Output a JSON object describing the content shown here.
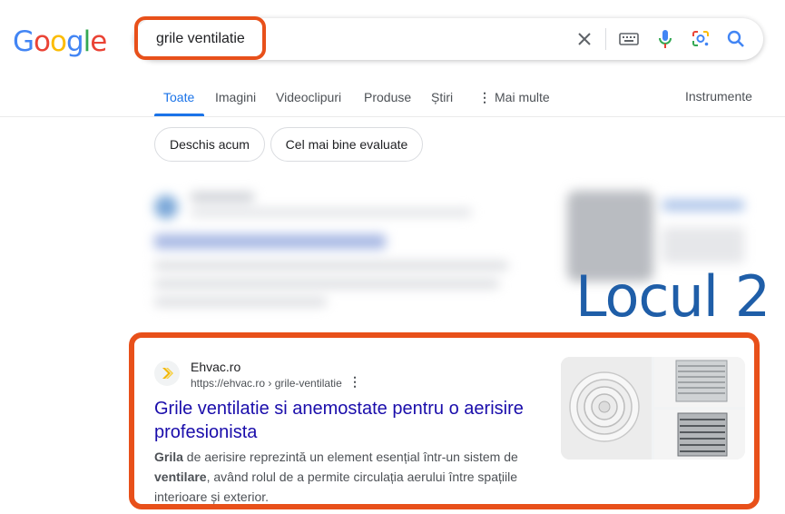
{
  "logo": {
    "letters": [
      "G",
      "o",
      "o",
      "g",
      "l",
      "e"
    ],
    "colors": [
      "#4285F4",
      "#EA4335",
      "#FBBC05",
      "#4285F4",
      "#34A853",
      "#EA4335"
    ]
  },
  "search": {
    "query": "grile ventilatie"
  },
  "tabs": [
    {
      "label": "Toate",
      "active": true
    },
    {
      "label": "Imagini"
    },
    {
      "label": "Videoclipuri"
    },
    {
      "label": "Produse"
    },
    {
      "label": "Știri"
    },
    {
      "label": "Mai multe"
    }
  ],
  "tools_label": "Instrumente",
  "chips": [
    "Deschis acum",
    "Cel mai bine evaluate"
  ],
  "annotation": "Locul 2",
  "result": {
    "site_name": "Ehvac.ro",
    "url": "https://ehvac.ro › grile-ventilatie",
    "title": "Grile ventilatie si anemostate pentru o aerisire profesionista",
    "snippet": {
      "bold1": "Grila",
      "text1": " de aerisire reprezintă un element esențial într-un sistem de ",
      "bold2": "ventilare",
      "text2": ", având rolul de a permite circulația aerului între spațiile interioare și exterior."
    }
  },
  "colors": {
    "accent": "#1a73e8",
    "link": "#1a0dab",
    "highlight": "#e8501a",
    "annotation": "#1f5ea8"
  }
}
